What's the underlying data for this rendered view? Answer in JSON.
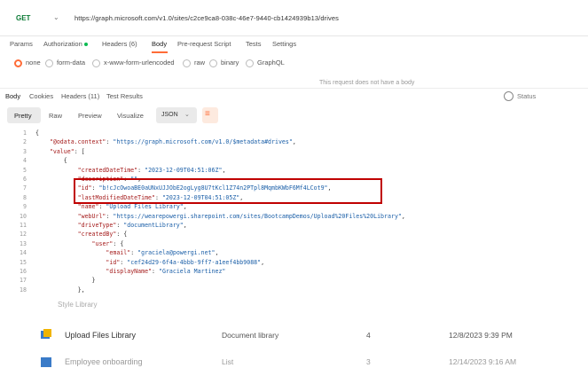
{
  "request": {
    "method": "GET",
    "url": "https://graph.microsoft.com/v1.0/sites/c2ce9ca8-038c-46e7-9440-cb1424939b13/drives"
  },
  "request_tabs": [
    "Params",
    "Authorization",
    "Headers (6)",
    "Body",
    "Pre-request Script",
    "Tests",
    "Settings"
  ],
  "body_options": [
    "none",
    "form-data",
    "x-www-form-urlencoded",
    "raw",
    "binary",
    "GraphQL"
  ],
  "no_body_message": "This request does not have a body",
  "response_tabs": [
    "Body",
    "Cookies",
    "Headers (11)",
    "Test Results"
  ],
  "status_label": "Status",
  "view_tabs": [
    "Pretty",
    "Raw",
    "Preview",
    "Visualize"
  ],
  "format": "JSON",
  "code_lines": [
    {
      "n": "1",
      "t": "{"
    },
    {
      "n": "2",
      "t": "    \"@odata.context\": \"https://graph.microsoft.com/v1.0/$metadata#drives\","
    },
    {
      "n": "3",
      "t": "    \"value\": ["
    },
    {
      "n": "4",
      "t": "        {"
    },
    {
      "n": "5",
      "t": "            \"createdDateTime\": \"2023-12-09T04:51:06Z\","
    },
    {
      "n": "6",
      "t": "            \"description\": \"\","
    },
    {
      "n": "7",
      "t": "            \"id\": \"b!cJcOwoaBE0aUNxUJJObE2ogLyg8U7tKcl1Z74n2PTpl8MqmbKWbF6Mf4LCot9\","
    },
    {
      "n": "8",
      "t": "            \"lastModifiedDateTime\": \"2023-12-09T04:51:05Z\","
    },
    {
      "n": "9",
      "t": "            \"name\": \"Upload Files Library\","
    },
    {
      "n": "10",
      "t": "            \"webUrl\": \"https://wearepowergi.sharepoint.com/sites/BootcampDemos/Upload%20Files%20Library\","
    },
    {
      "n": "11",
      "t": "            \"driveType\": \"documentLibrary\","
    },
    {
      "n": "12",
      "t": "            \"createdBy\": {"
    },
    {
      "n": "13",
      "t": "                \"user\": {"
    },
    {
      "n": "14",
      "t": "                    \"email\": \"graciela@powergi.net\","
    },
    {
      "n": "15",
      "t": "                    \"id\": \"cef24d29-6f4a-4bbb-9ff7-a1eef4bb9088\","
    },
    {
      "n": "16",
      "t": "                    \"displayName\": \"Graciela Martinez\""
    },
    {
      "n": "17",
      "t": "                }"
    },
    {
      "n": "18",
      "t": "            },"
    }
  ],
  "sharepoint_rows": [
    {
      "name": "Upload Files Library",
      "type": "Document library",
      "count": "4",
      "modified": "12/8/2023 9:39 PM"
    },
    {
      "name": "Employee onboarding",
      "type": "List",
      "count": "3",
      "modified": "12/14/2023 9:16 AM"
    }
  ],
  "partial_item": "Style Library",
  "colors": {
    "accent": "#ff6c37",
    "get": "#0b7a35",
    "highlight": "#c00000"
  }
}
